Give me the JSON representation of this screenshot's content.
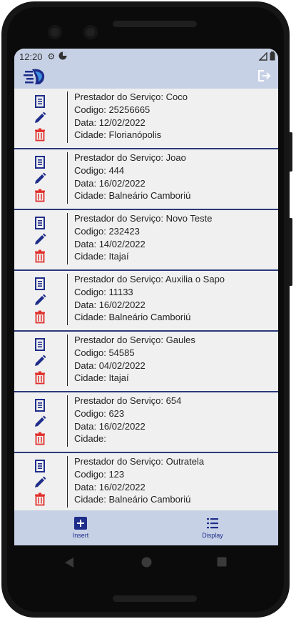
{
  "status_bar": {
    "time": "12:20"
  },
  "app_bar": {
    "logo_icon": "app-logo-icon",
    "logout_icon": "logout-icon"
  },
  "list_labels": {
    "provider": "Prestador do Serviço:",
    "code": "Codigo:",
    "date": "Data:",
    "city": "Cidade:"
  },
  "items": [
    {
      "provider": "Coco",
      "code": "25256665",
      "date": "12/02/2022",
      "city": "Florianópolis"
    },
    {
      "provider": "Joao",
      "code": "444",
      "date": "16/02/2022",
      "city": "Balneário Camboriú"
    },
    {
      "provider": "Novo Teste",
      "code": "232423",
      "date": "14/02/2022",
      "city": "Itajaí"
    },
    {
      "provider": "Auxilia o Sapo",
      "code": "11133",
      "date": "16/02/2022",
      "city": "Balneário Camboriú"
    },
    {
      "provider": "Gaules",
      "code": "54585",
      "date": "04/02/2022",
      "city": "Itajaí"
    },
    {
      "provider": "654",
      "code": "623",
      "date": "16/02/2022",
      "city": ""
    },
    {
      "provider": "Outratela",
      "code": "123",
      "date": "16/02/2022",
      "city": "Balneário Camboriú"
    }
  ],
  "bottom_nav": {
    "insert_label": "Insert",
    "display_label": "Display"
  },
  "colors": {
    "accent": "#1e2d8a",
    "delete": "#e0302b",
    "bar": "#c7d1e6"
  }
}
